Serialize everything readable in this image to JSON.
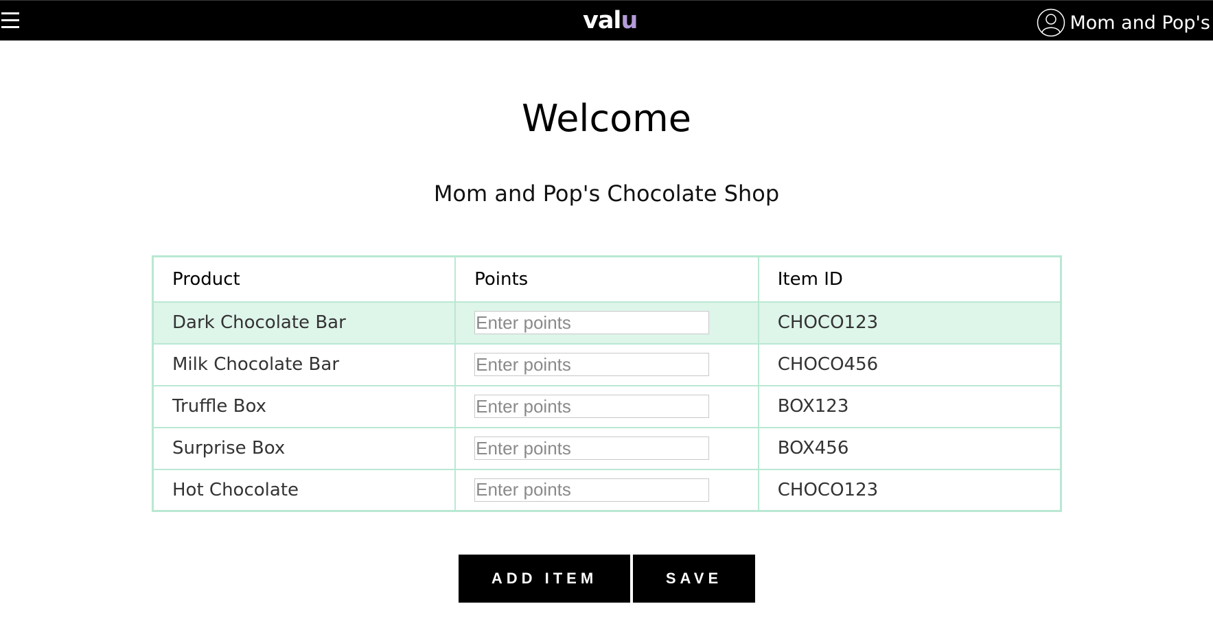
{
  "header": {
    "logo_main": "val",
    "logo_accent": "u",
    "account_name": "Mom and Pop's"
  },
  "page": {
    "title": "Welcome",
    "subtitle": "Mom and Pop's Chocolate Shop"
  },
  "table": {
    "columns": [
      "Product",
      "Points",
      "Item ID"
    ],
    "rows": [
      {
        "product": "Dark Chocolate Bar",
        "points_value": "",
        "points_placeholder": "Enter points",
        "item_id": "CHOCO123",
        "highlighted": true
      },
      {
        "product": "Milk Chocolate Bar",
        "points_value": "",
        "points_placeholder": "Enter points",
        "item_id": "CHOCO456",
        "highlighted": false
      },
      {
        "product": "Truffle Box",
        "points_value": "",
        "points_placeholder": "Enter points",
        "item_id": "BOX123",
        "highlighted": false
      },
      {
        "product": "Surprise Box",
        "points_value": "",
        "points_placeholder": "Enter points",
        "item_id": "BOX456",
        "highlighted": false
      },
      {
        "product": "Hot Chocolate",
        "points_value": "",
        "points_placeholder": "Enter points",
        "item_id": "CHOCO123",
        "highlighted": false
      }
    ]
  },
  "actions": {
    "add_item_label": "ADD ITEM",
    "save_label": "SAVE"
  },
  "icons": {
    "menu": "hamburger-menu-icon",
    "account": "user-circle-icon"
  },
  "colors": {
    "topbar": "#000000",
    "logo_accent": "#b49bd9",
    "table_border": "#b9e8d3",
    "row_highlight": "#def5ea",
    "button_bg": "#000000"
  }
}
